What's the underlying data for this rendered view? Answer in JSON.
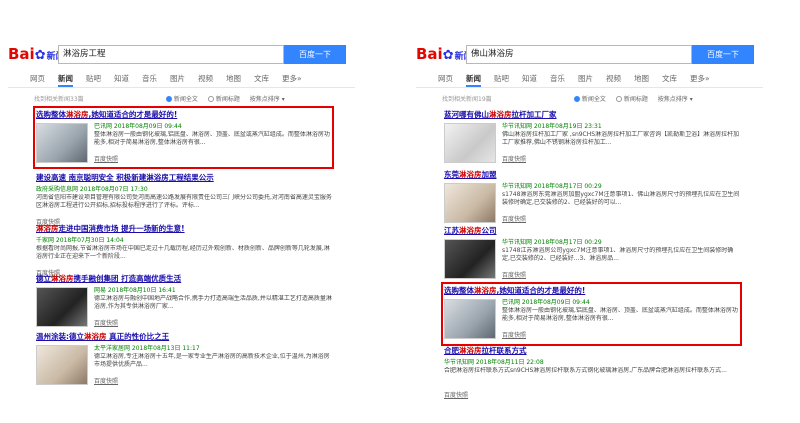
{
  "left": {
    "logo": {
      "bai": "Bai",
      "paw": "✿",
      "news": "新闻"
    },
    "query": "淋浴房工程",
    "search_button": "百度一下",
    "tabs": [
      "网页",
      "新闻",
      "贴吧",
      "知道",
      "音乐",
      "图片",
      "视频",
      "地图",
      "文库",
      "更多»"
    ],
    "result_count": "找到相关新闻33篇",
    "sort_options": [
      "新闻全文",
      "新闻标题",
      "按焦点排序"
    ],
    "results": [
      {
        "title_pre": "选购整体",
        "title_hl": "淋浴房",
        "title_post": ",她知道适合的才是最好的!",
        "source": "巴讯网  2018年08月09日 09:44",
        "snippet": "整体淋浴房一般由钢化玻璃,铝底盘、淋浴房、顶盖、底盆或蒸汽缸组成。而整体淋浴房功能多,相对于简易淋浴房,整体淋浴房有很...",
        "cache": "百度快照"
      },
      {
        "title_pre": "建设高速 ",
        "title_hl": "",
        "title_post": "南京聪明安全 积极新建淋浴房工程结果公示",
        "source": "政府采购信息网  2018年08月07日 17:30",
        "snippet": "河南省信阳市建设项目管理有限公司受河南高速公路发展有限责任公司三门峡分公司委托,对河南省高速灵宝服务区淋浴房工程进行公开招标,招标投标程序进行了评标。评标...",
        "cache": "百度快照"
      },
      {
        "title_pre": "",
        "title_hl": "淋浴房",
        "title_post": "走进中国消费市场 提升一场新的生意!",
        "source": "千家网  2018年07月30日 14:04",
        "snippet": "根据看时尚网报,节省淋浴房市场在中国已走过十几载历程,经历过外观创新、材质创新、品牌创新等几轮发展,淋浴房行业正在迎来下一个新阶段...",
        "cache": "百度快照"
      },
      {
        "title_pre": "德立",
        "title_hl": "淋浴房",
        "title_post": "携手融创集团 打造高端优质生活",
        "source": "网易  2018年08月10日 16:41",
        "snippet": "德立淋浴房与融创中国地产战略合作,携手力打造高端生活品质,并以精湛工艺打造高质量淋浴房,作为其专供淋浴房厂家...",
        "cache": "百度快照"
      },
      {
        "title_pre": "温州涂装:德立",
        "title_hl": "淋浴房",
        "title_post": " 真正的性价比之王",
        "source": "太平洋家居网  2018年08月13日 11:17",
        "snippet": "德立淋浴房,专注淋浴房十五年,是一家专业生产淋浴房的高新技术企业,位于温州,为淋浴房市场提供优质产品...",
        "cache": "百度快照"
      }
    ]
  },
  "right": {
    "logo": {
      "bai": "Bai",
      "paw": "✿",
      "news": "新闻"
    },
    "query": "佛山淋浴房",
    "search_button": "百度一下",
    "tabs": [
      "网页",
      "新闻",
      "贴吧",
      "知道",
      "音乐",
      "图片",
      "视频",
      "地图",
      "文库",
      "更多»"
    ],
    "result_count": "找到相关新闻19篇",
    "sort_options": [
      "新闻全文",
      "新闻标题",
      "按焦点排序"
    ],
    "results": [
      {
        "title_pre": "蓝河哪有佛山",
        "title_hl": "淋浴房",
        "title_post": "拉杆加工厂家",
        "source": "华节讯知网  2018年08月19日 23:31",
        "snippet": "佛山淋浴房拉杆加工厂家 ,sn9CHS淋浴房拉杆加工厂家咨询【凯勒斯卫浴】淋浴房拉杆加工厂家推荐,佛山不锈钢淋浴房拉杆加工...",
        "cache": "百度快照"
      },
      {
        "title_pre": "东莞",
        "title_hl": "淋浴房",
        "title_post": "加盟",
        "source": "华节讯知网  2018年08月17日 00:29",
        "snippet": "s1748淋浴房东莞淋浴房加盟ygxc7M注意事项1、佛山淋浴房尺寸的预埋孔位应在卫生间装修时确定,已交装修的2、已经装好的可以...",
        "cache": "百度快照"
      },
      {
        "title_pre": "江苏",
        "title_hl": "淋浴房",
        "title_post": "公司",
        "source": "华节讯知网  2018年08月17日 00:29",
        "snippet": "s1748江苏淋浴房公司ygxc7M注意事项1、淋浴房尺寸的预埋孔位应在卫生间装修时确定,已交装修的2、已经装好...3、淋浴房品...",
        "cache": "百度快照"
      },
      {
        "title_pre": "选购整体",
        "title_hl": "淋浴房",
        "title_post": ",她知道适合的才是最好的!",
        "source": "巴讯网  2018年08月09日 09:44",
        "snippet": "整体淋浴房一般由钢化玻璃,铝底盘、淋浴房、顶盖、底盆或蒸汽缸组成。而整体淋浴房功能多,相对于简易淋浴房,整体淋浴房有很...",
        "cache": "百度快照"
      },
      {
        "title_pre": "合肥",
        "title_hl": "淋浴房",
        "title_post": "拉杆联系方式",
        "source": "华节讯知网  2018年08月11日 22:08",
        "snippet": "合肥淋浴房拉杆联系方式sn9CHS淋浴房拉杆联系方式钢化玻璃淋浴房,广东品牌合肥淋浴房拉杆联系方式...",
        "cache": "百度快照"
      }
    ]
  }
}
